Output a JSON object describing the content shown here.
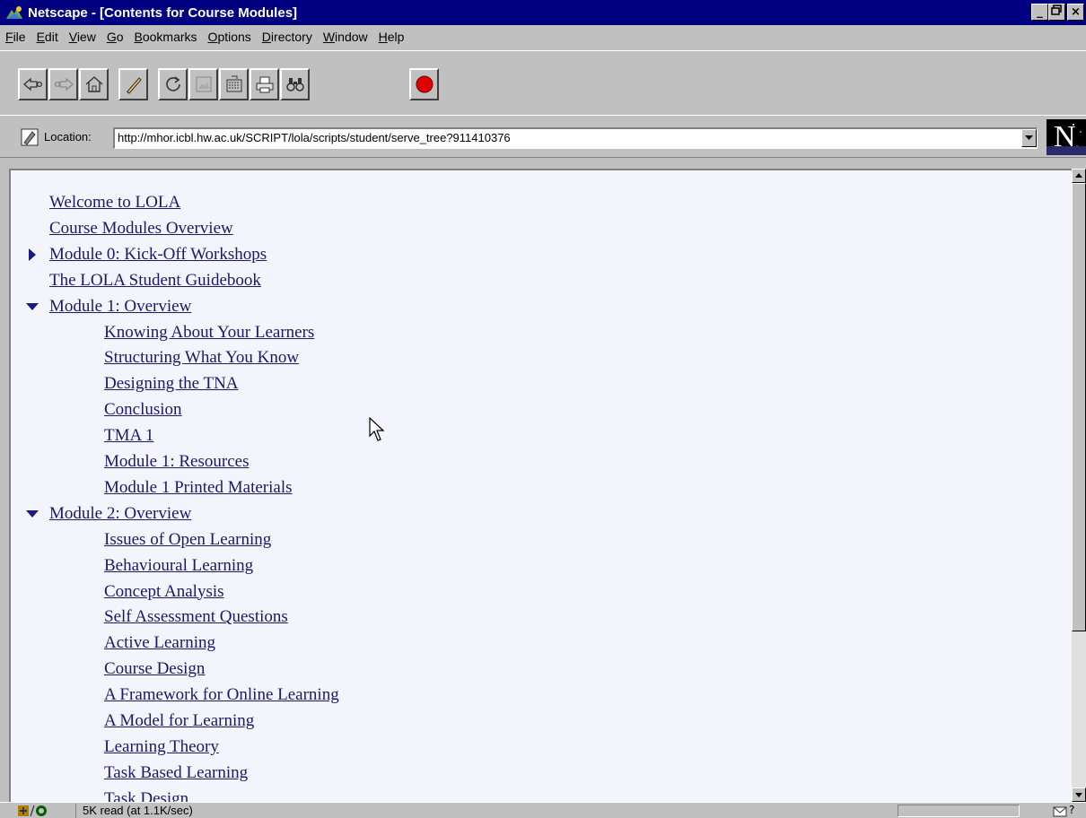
{
  "window": {
    "title": "Netscape - [Contents for Course Modules]",
    "buttons": [
      "_",
      "×"
    ],
    "maximize_glyph": "¡"
  },
  "menu": [
    {
      "u": "F",
      "rest": "ile"
    },
    {
      "u": "E",
      "rest": "dit"
    },
    {
      "u": "V",
      "rest": "iew"
    },
    {
      "u": "G",
      "rest": "o"
    },
    {
      "u": "B",
      "rest": "ookmarks"
    },
    {
      "u": "O",
      "rest": "ptions"
    },
    {
      "u": "D",
      "rest": "irectory"
    },
    {
      "u": "W",
      "rest": "indow"
    },
    {
      "u": "H",
      "rest": "elp"
    }
  ],
  "toolbar": {
    "buttons": [
      "back-icon",
      "forward-icon",
      "home-icon",
      "edit-icon",
      "reload-icon",
      "images-icon",
      "open-icon",
      "print-icon",
      "find-icon",
      "stop-icon"
    ]
  },
  "location": {
    "label": "Location:",
    "url": "http://mhor.icbl.hw.ac.uk/SCRIPT/lola/scripts/student/serve_tree?911410376",
    "logo_letter": "N"
  },
  "tree": [
    {
      "label": "Welcome to LOLA",
      "level": 0,
      "toggle": "none"
    },
    {
      "label": "Course Modules Overview",
      "level": 0,
      "toggle": "none"
    },
    {
      "label": "Module 0: Kick-Off Workshops",
      "level": 0,
      "toggle": "collapsed"
    },
    {
      "label": "The LOLA Student Guidebook",
      "level": 0,
      "toggle": "none"
    },
    {
      "label": "Module 1: Overview",
      "level": 0,
      "toggle": "expanded"
    },
    {
      "label": "Knowing About Your Learners",
      "level": 1,
      "toggle": "none"
    },
    {
      "label": "Structuring What You Know",
      "level": 1,
      "toggle": "none"
    },
    {
      "label": "Designing the TNA",
      "level": 1,
      "toggle": "none"
    },
    {
      "label": "Conclusion",
      "level": 1,
      "toggle": "none"
    },
    {
      "label": "TMA 1",
      "level": 1,
      "toggle": "none"
    },
    {
      "label": "Module 1: Resources",
      "level": 1,
      "toggle": "none"
    },
    {
      "label": "Module 1 Printed Materials",
      "level": 1,
      "toggle": "none"
    },
    {
      "label": "Module 2: Overview",
      "level": 0,
      "toggle": "expanded"
    },
    {
      "label": "Issues of Open Learning",
      "level": 1,
      "toggle": "none"
    },
    {
      "label": "Behavioural Learning",
      "level": 1,
      "toggle": "none"
    },
    {
      "label": "Concept Analysis",
      "level": 1,
      "toggle": "none"
    },
    {
      "label": "Self Assessment Questions",
      "level": 1,
      "toggle": "none"
    },
    {
      "label": "Active Learning",
      "level": 1,
      "toggle": "none"
    },
    {
      "label": "Course Design",
      "level": 1,
      "toggle": "none"
    },
    {
      "label": "A Framework for Online Learning",
      "level": 1,
      "toggle": "none"
    },
    {
      "label": "A Model for Learning",
      "level": 1,
      "toggle": "none"
    },
    {
      "label": "Learning Theory",
      "level": 1,
      "toggle": "none"
    },
    {
      "label": "Task Based Learning",
      "level": 1,
      "toggle": "none"
    },
    {
      "label": "Task Design",
      "level": 1,
      "toggle": "none"
    }
  ],
  "status": {
    "text": "5K read (at 1.1K/sec)",
    "progress": 0.0
  },
  "colors": {
    "link": "#1a1a66",
    "title_bar": "#000080",
    "content_bg": "#f4f4fc",
    "caret": "#1a1a80"
  }
}
